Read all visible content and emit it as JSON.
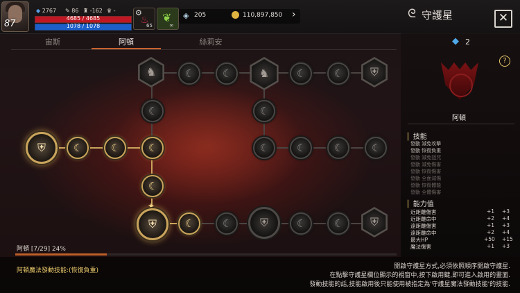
{
  "player": {
    "level": "87",
    "hp": "4685 / 4685",
    "hp_fraction": 1.0,
    "mp": "1078 / 1078",
    "mp_fraction": 1.0,
    "stat1": "2767",
    "stat2": "86",
    "stat3": "-162",
    "stat4": "-"
  },
  "items": {
    "potion_count": "65",
    "infinite_label": "∞"
  },
  "currency": {
    "crystals": "205",
    "gold": "110,897,850"
  },
  "header": {
    "title": "守護星",
    "close_icon": "close-icon"
  },
  "tabs": [
    {
      "label": "宙斯"
    },
    {
      "label": "阿頓"
    },
    {
      "label": "絲莉安"
    }
  ],
  "active_tab": 1,
  "progress": {
    "label": "阿頓 [7/29] 24%",
    "fraction": 0.24
  },
  "constellation": {
    "name": "阿頓",
    "points": "2",
    "help": "?"
  },
  "skills": {
    "heading": "技能",
    "items": [
      {
        "text": "發動 減免攻擊",
        "active": true
      },
      {
        "text": "發動 恢復負重",
        "active": true
      },
      {
        "text": "發動 減免詛咒",
        "active": false
      },
      {
        "text": "發動 減免傷害",
        "active": false
      },
      {
        "text": "發動 恢復傷害",
        "active": false
      },
      {
        "text": "發動 全面減傷",
        "active": false
      },
      {
        "text": "發動 恢復體能",
        "active": false
      },
      {
        "text": "發動 全體傷害",
        "active": false
      }
    ]
  },
  "stats": {
    "heading": "能力值",
    "rows": [
      {
        "name": "近距離傷害",
        "cur": "+1",
        "next": "+3"
      },
      {
        "name": "近距離命中",
        "cur": "+2",
        "next": "+4"
      },
      {
        "name": "遠距離傷害",
        "cur": "+1",
        "next": "+3"
      },
      {
        "name": "遠距離命中",
        "cur": "+2",
        "next": "+4"
      },
      {
        "name": "最大HP",
        "cur": "+50",
        "next": "+15"
      },
      {
        "name": "魔法傷害",
        "cur": "+1",
        "next": "+3"
      }
    ]
  },
  "bottom": {
    "skill_label": "阿頓魔法發動技能:(恢復負重)",
    "help_lines": [
      "開啟守護星方式,必須依照順序開啟守護星.",
      "在點擊守護星欄位顯示的視窗中,按下啟用鍵,即可進入啟用的畫面.",
      "發動技能的話,技能啟用後只能使用被指定為'守護星魔法發動技能'的技能."
    ]
  },
  "colors": {
    "accent": "#c9622e",
    "gold": "#c9a45c",
    "hp": "#c01822",
    "mp": "#1c5fc8"
  }
}
